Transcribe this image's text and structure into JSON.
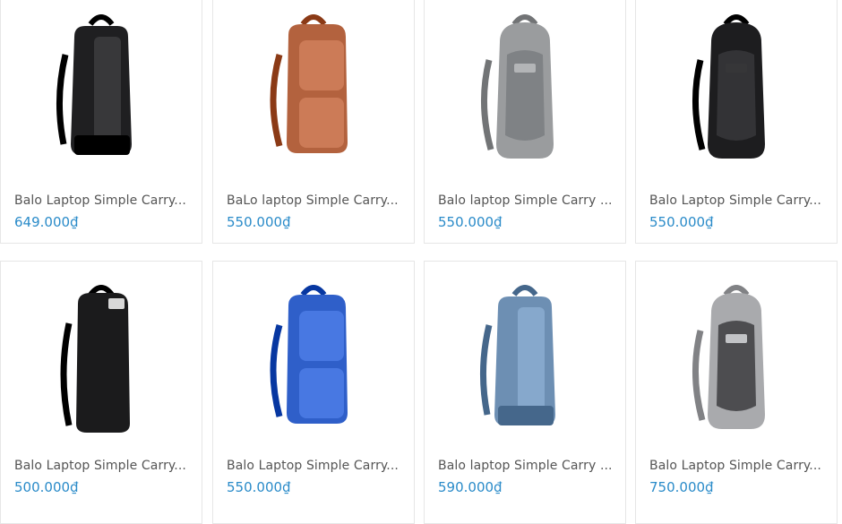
{
  "colors": {
    "price": "#2a8bc9",
    "name": "#555555",
    "card_border": "#e6e6e6"
  },
  "products": [
    {
      "name": "Balo Laptop Simple Carry...",
      "price": "649.000₫",
      "image": "black-backpack-image",
      "bag_color": "#1f1f21",
      "accent": "#3a3a3c",
      "style": "tall"
    },
    {
      "name": "BaLo laptop Simple Carry...",
      "price": "550.000₫",
      "image": "brown-backpack-image",
      "bag_color": "#b3623e",
      "accent": "#c97752",
      "style": "double"
    },
    {
      "name": "Balo laptop Simple Carry ...",
      "price": "550.000₫",
      "image": "grey-backpack-image",
      "bag_color": "#9a9c9e",
      "accent": "#7f8285",
      "style": "round"
    },
    {
      "name": "Balo Laptop Simple Carry...",
      "price": "550.000₫",
      "image": "black-round-backpack-image",
      "bag_color": "#1d1d1f",
      "accent": "#333336",
      "style": "round"
    },
    {
      "name": "Balo Laptop Simple Carry...",
      "price": "500.000₫",
      "image": "black-slim-backpack-image",
      "bag_color": "#1b1b1c",
      "accent": "#2f2f31",
      "style": "slim"
    },
    {
      "name": "Balo Laptop Simple Carry...",
      "price": "550.000₫",
      "image": "blue-backpack-image",
      "bag_color": "#2f5fc9",
      "accent": "#4a7ae0",
      "style": "double"
    },
    {
      "name": "Balo laptop Simple Carry ...",
      "price": "590.000₫",
      "image": "light-blue-backpack-image",
      "bag_color": "#6d8fb3",
      "accent": "#5b7ea3",
      "style": "tall"
    },
    {
      "name": "Balo Laptop Simple Carry...",
      "price": "750.000₫",
      "image": "grey-charcoal-backpack-image",
      "bag_color": "#a9aaad",
      "accent": "#4d4d50",
      "style": "round"
    }
  ]
}
